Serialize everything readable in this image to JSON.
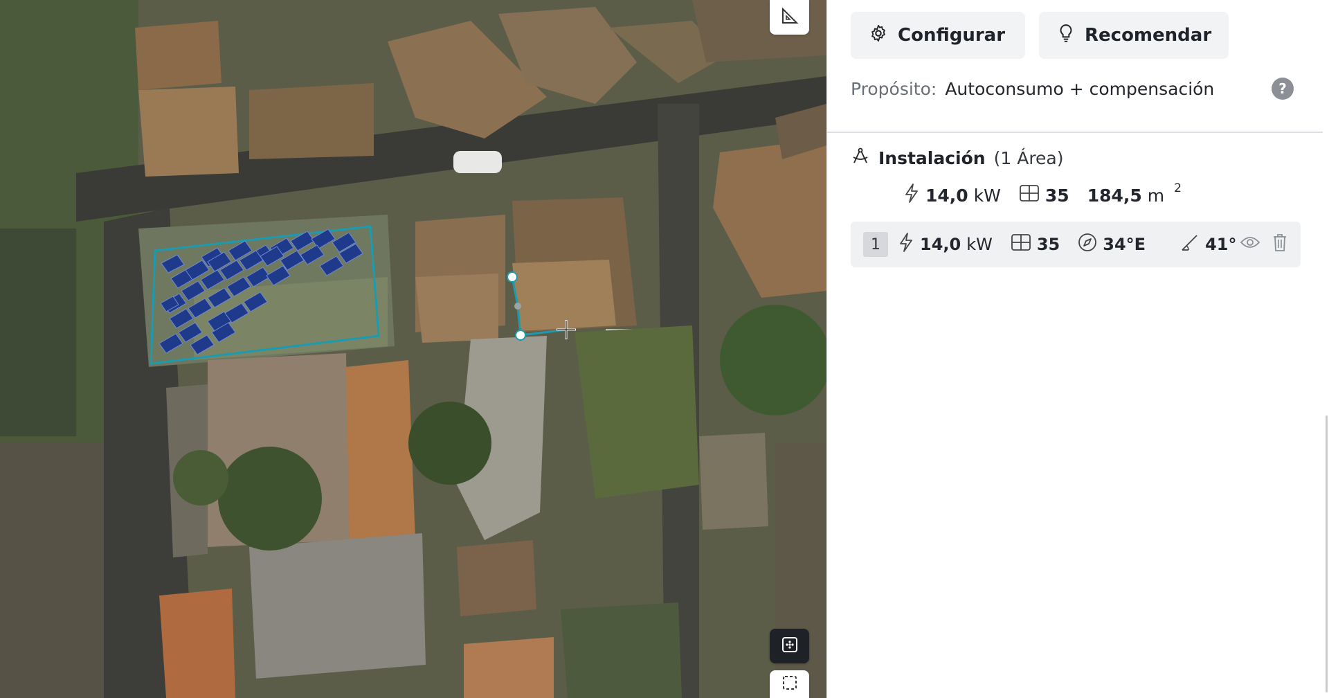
{
  "toolbar": {
    "configure_label": "Configurar",
    "recommend_label": "Recomendar"
  },
  "purpose": {
    "label": "Propósito:",
    "value": "Autoconsumo + compensación",
    "help_glyph": "?"
  },
  "installation": {
    "title": "Instalación",
    "count_text": "(1 Área)",
    "power_value": "14,0",
    "power_unit": "kW",
    "modules": "35",
    "area_value": "184,5",
    "area_unit": "m",
    "area_exp": "2"
  },
  "areas": [
    {
      "index": "1",
      "power_value": "14,0",
      "power_unit": "kW",
      "modules": "35",
      "orientation": "34°E",
      "tilt": "41°"
    }
  ],
  "icons": {
    "configure": "gear-icon",
    "recommend": "lightbulb-icon",
    "installation": "drawing-compass-icon",
    "power": "lightning-icon",
    "modules": "panel-grid-icon",
    "orientation": "compass-icon",
    "tilt": "tilt-angle-icon",
    "visibility": "eye-icon",
    "delete": "trash-icon",
    "measure": "set-square-icon",
    "grid_tool": "grid-dots-icon",
    "select_tool": "dashed-selection-icon"
  },
  "colors": {
    "area_outline": "#1a9bb0",
    "panel_fill": "#1f3a8a",
    "button_bg": "#f2f3f5",
    "row_bg": "#f0f1f3"
  }
}
